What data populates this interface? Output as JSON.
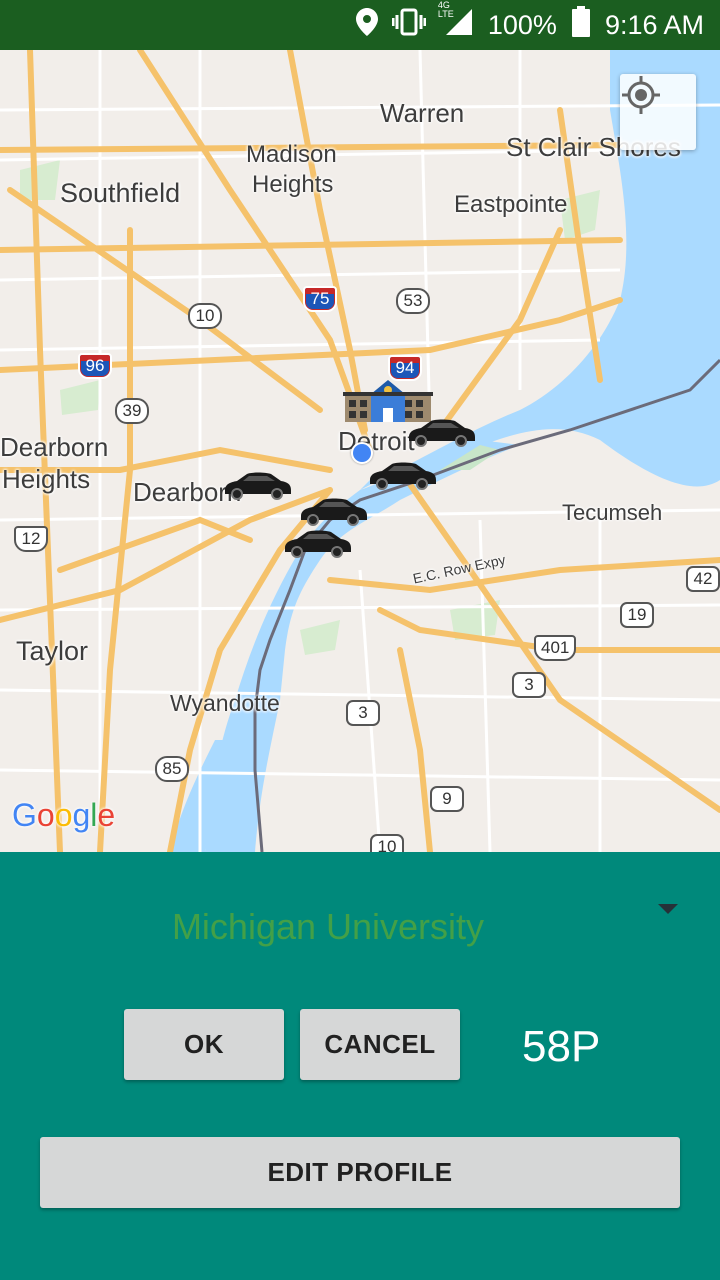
{
  "status_bar": {
    "network_type": "4G LTE",
    "battery": "100%",
    "time": "9:16 AM",
    "background_color": "#1b5e20",
    "icons": [
      "location-icon",
      "vibrate-icon",
      "signal-icon",
      "battery-icon"
    ]
  },
  "map": {
    "labels": {
      "warren": "Warren",
      "st_clair_shores": "St Clair Shores",
      "madison": "Madison",
      "heights": "Heights",
      "southfield": "Southfield",
      "eastpointe": "Eastpointe",
      "dearborn_heights_1": "Dearborn",
      "dearborn_heights_2": "Heights",
      "dearborn": "Dearborn",
      "detroit": "Detroit",
      "tecumseh": "Tecumseh",
      "ec_row": "E.C. Row Expy",
      "taylor": "Taylor",
      "wyandotte": "Wyandotte"
    },
    "shields": {
      "s75": "75",
      "s53": "53",
      "s10a": "10",
      "s96": "96",
      "s94": "94",
      "s39": "39",
      "s12": "12",
      "s42": "42",
      "s19": "19",
      "s401": "401",
      "s3a": "3",
      "s3b": "3",
      "s85": "85",
      "s9": "9",
      "s10b": "10"
    },
    "google_logo": [
      "G",
      "o",
      "o",
      "g",
      "l",
      "e"
    ],
    "car_marker_count": 5
  },
  "panel": {
    "background_color": "#00897b",
    "selected_place": "Michigan University",
    "ok_label": "OK",
    "cancel_label": "CANCEL",
    "points": "58P",
    "edit_profile_label": "EDIT PROFILE"
  }
}
